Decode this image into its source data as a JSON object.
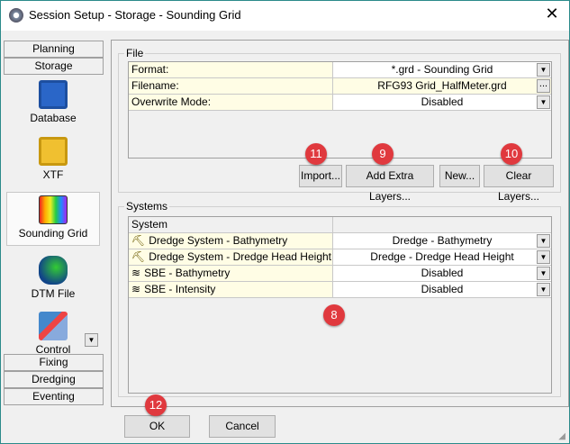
{
  "window": {
    "title": "Session Setup - Storage -  Sounding Grid",
    "close": "✕"
  },
  "sidebar": {
    "tabs_top": [
      "Planning",
      "Storage"
    ],
    "items": [
      {
        "label": "Database",
        "icon": "floppy-disk-icon"
      },
      {
        "label": "XTF",
        "icon": "xtf-floppy-icon"
      },
      {
        "label": "Sounding Grid",
        "icon": "grid-icon",
        "selected": true
      },
      {
        "label": "DTM File",
        "icon": "dtm-icon"
      },
      {
        "label": "Control",
        "icon": "control-icon"
      }
    ],
    "tabs_bottom": [
      "Fixing",
      "Dredging",
      "Eventing"
    ]
  },
  "file": {
    "group_label": "File",
    "rows": [
      {
        "label": "Format:",
        "value": "*.grd - Sounding Grid",
        "control": "dropdown"
      },
      {
        "label": "Filename:",
        "value": "RFG93 Grid_HalfMeter.grd",
        "control": "browse",
        "button": "..."
      },
      {
        "label": "Overwrite Mode:",
        "value": "Disabled",
        "control": "dropdown"
      }
    ],
    "buttons": {
      "import": "Import...",
      "add_layers": "Add Extra Layers...",
      "new": "New...",
      "clear_layers": "Clear Layers..."
    }
  },
  "systems": {
    "group_label": "Systems",
    "header": "System",
    "rows": [
      {
        "name": "Dredge System - Bathymetry",
        "value": "Dredge - Bathymetry",
        "icon": "dredge-icon"
      },
      {
        "name": "Dredge System - Dredge Head Height",
        "value": "Dredge - Dredge Head Height",
        "icon": "dredge-icon"
      },
      {
        "name": "SBE - Bathymetry",
        "value": "Disabled",
        "icon": "sbe-icon"
      },
      {
        "name": "SBE - Intensity",
        "value": "Disabled",
        "icon": "sbe-icon"
      }
    ]
  },
  "badges": {
    "b8": "8",
    "b9": "9",
    "b10": "10",
    "b11": "11",
    "b12": "12"
  },
  "footer": {
    "ok": "OK",
    "cancel": "Cancel"
  },
  "colors": {
    "badge": "#e0393e",
    "cell_label": "#fffde5"
  }
}
